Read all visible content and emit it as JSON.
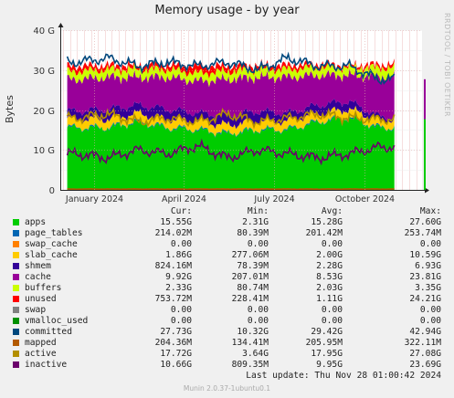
{
  "title": "Memory usage - by year",
  "ylabel": "Bytes",
  "watermark": "RRDTOOL / TOBI OETIKER",
  "legend_header": {
    "cur": "Cur:",
    "min": "Min:",
    "avg": "Avg:",
    "max": "Max:"
  },
  "legend": [
    {
      "name": "apps",
      "color": "#00cc00",
      "cur": "15.55G",
      "min": "2.31G",
      "avg": "15.28G",
      "max": "27.60G"
    },
    {
      "name": "page_tables",
      "color": "#0066b3",
      "cur": "214.02M",
      "min": "80.39M",
      "avg": "201.42M",
      "max": "253.74M"
    },
    {
      "name": "swap_cache",
      "color": "#ff8000",
      "cur": "0.00",
      "min": "0.00",
      "avg": "0.00",
      "max": "0.00"
    },
    {
      "name": "slab_cache",
      "color": "#ffcc00",
      "cur": "1.86G",
      "min": "277.06M",
      "avg": "2.00G",
      "max": "10.59G"
    },
    {
      "name": "shmem",
      "color": "#330099",
      "cur": "824.16M",
      "min": "78.39M",
      "avg": "2.28G",
      "max": "6.93G"
    },
    {
      "name": "cache",
      "color": "#990099",
      "cur": "9.92G",
      "min": "207.01M",
      "avg": "8.53G",
      "max": "23.81G"
    },
    {
      "name": "buffers",
      "color": "#ccff00",
      "cur": "2.33G",
      "min": "80.74M",
      "avg": "2.03G",
      "max": "3.35G"
    },
    {
      "name": "unused",
      "color": "#ff0000",
      "cur": "753.72M",
      "min": "228.41M",
      "avg": "1.11G",
      "max": "24.21G"
    },
    {
      "name": "swap",
      "color": "#808080",
      "cur": "0.00",
      "min": "0.00",
      "avg": "0.00",
      "max": "0.00"
    },
    {
      "name": "vmalloc_used",
      "color": "#008f00",
      "cur": "0.00",
      "min": "0.00",
      "avg": "0.00",
      "max": "0.00"
    },
    {
      "name": "committed",
      "color": "#00487d",
      "cur": "27.73G",
      "min": "10.32G",
      "avg": "29.42G",
      "max": "42.94G"
    },
    {
      "name": "mapped",
      "color": "#b35a00",
      "cur": "204.36M",
      "min": "134.41M",
      "avg": "205.95M",
      "max": "322.11M"
    },
    {
      "name": "active",
      "color": "#b38f00",
      "cur": "17.72G",
      "min": "3.64G",
      "avg": "17.95G",
      "max": "27.08G"
    },
    {
      "name": "inactive",
      "color": "#6b006b",
      "cur": "10.66G",
      "min": "809.35M",
      "avg": "9.95G",
      "max": "23.69G"
    }
  ],
  "last_update": "Last update: Thu Nov 28 01:00:42 2024",
  "footer": "Munin 2.0.37-1ubuntu0.1",
  "chart_data": {
    "type": "area",
    "title": "Memory usage - by year",
    "ylabel": "Bytes",
    "ylim": [
      0,
      40
    ],
    "y_unit": "G",
    "yticks": [
      "0",
      "10 G",
      "20 G",
      "30 G",
      "40 G"
    ],
    "xlim": [
      "2023-11-28",
      "2024-11-28"
    ],
    "xticks": [
      "January 2024",
      "April 2024",
      "July 2024",
      "October 2024"
    ],
    "x": [
      "2023-12",
      "2024-01",
      "2024-02",
      "2024-03",
      "2024-04",
      "2024-05",
      "2024-06",
      "2024-07",
      "2024-08",
      "2024-09",
      "2024-10"
    ],
    "stacked": [
      {
        "name": "apps",
        "color": "#00cc00",
        "values": [
          15.5,
          15.5,
          17,
          15.5,
          15,
          14,
          15,
          15,
          17,
          18,
          15.5
        ]
      },
      {
        "name": "page_tables",
        "color": "#0066b3",
        "values": [
          0.2,
          0.2,
          0.2,
          0.2,
          0.2,
          0.2,
          0.2,
          0.2,
          0.2,
          0.2,
          0.2
        ]
      },
      {
        "name": "slab_cache",
        "color": "#ffcc00",
        "values": [
          2,
          2,
          2,
          2,
          2,
          2,
          2,
          2,
          2,
          2,
          1.9
        ]
      },
      {
        "name": "shmem",
        "color": "#330099",
        "values": [
          2,
          2.5,
          2,
          2.5,
          2,
          2.5,
          2.5,
          2,
          2,
          2,
          0.8
        ]
      },
      {
        "name": "cache",
        "color": "#990099",
        "values": [
          8,
          8,
          7,
          8,
          8,
          9,
          8.5,
          9,
          7.5,
          6.5,
          9.9
        ]
      },
      {
        "name": "buffers",
        "color": "#ccff00",
        "values": [
          2,
          2,
          2,
          2,
          2,
          2,
          2,
          2,
          2,
          2,
          2.3
        ]
      },
      {
        "name": "unused",
        "color": "#ff0000",
        "values": [
          1.3,
          1,
          1,
          1,
          1.8,
          1.3,
          1,
          1,
          0.8,
          0.5,
          0.8
        ]
      }
    ],
    "lines": [
      {
        "name": "committed",
        "color": "#00487d",
        "values": [
          32,
          33,
          31,
          32,
          31,
          32,
          30,
          33,
          31,
          31,
          27.7
        ]
      },
      {
        "name": "mapped",
        "color": "#b35a00",
        "values": [
          0.2,
          0.2,
          0.2,
          0.2,
          0.2,
          0.2,
          0.2,
          0.2,
          0.2,
          0.2,
          0.2
        ]
      },
      {
        "name": "active",
        "color": "#b38f00",
        "values": [
          18,
          19,
          17,
          18,
          17,
          19,
          17,
          18,
          19,
          18,
          17.7
        ]
      },
      {
        "name": "inactive",
        "color": "#6b006b",
        "values": [
          9,
          8,
          10,
          9,
          11,
          8,
          10,
          9,
          8,
          9,
          10.7
        ]
      }
    ],
    "grid": true
  }
}
